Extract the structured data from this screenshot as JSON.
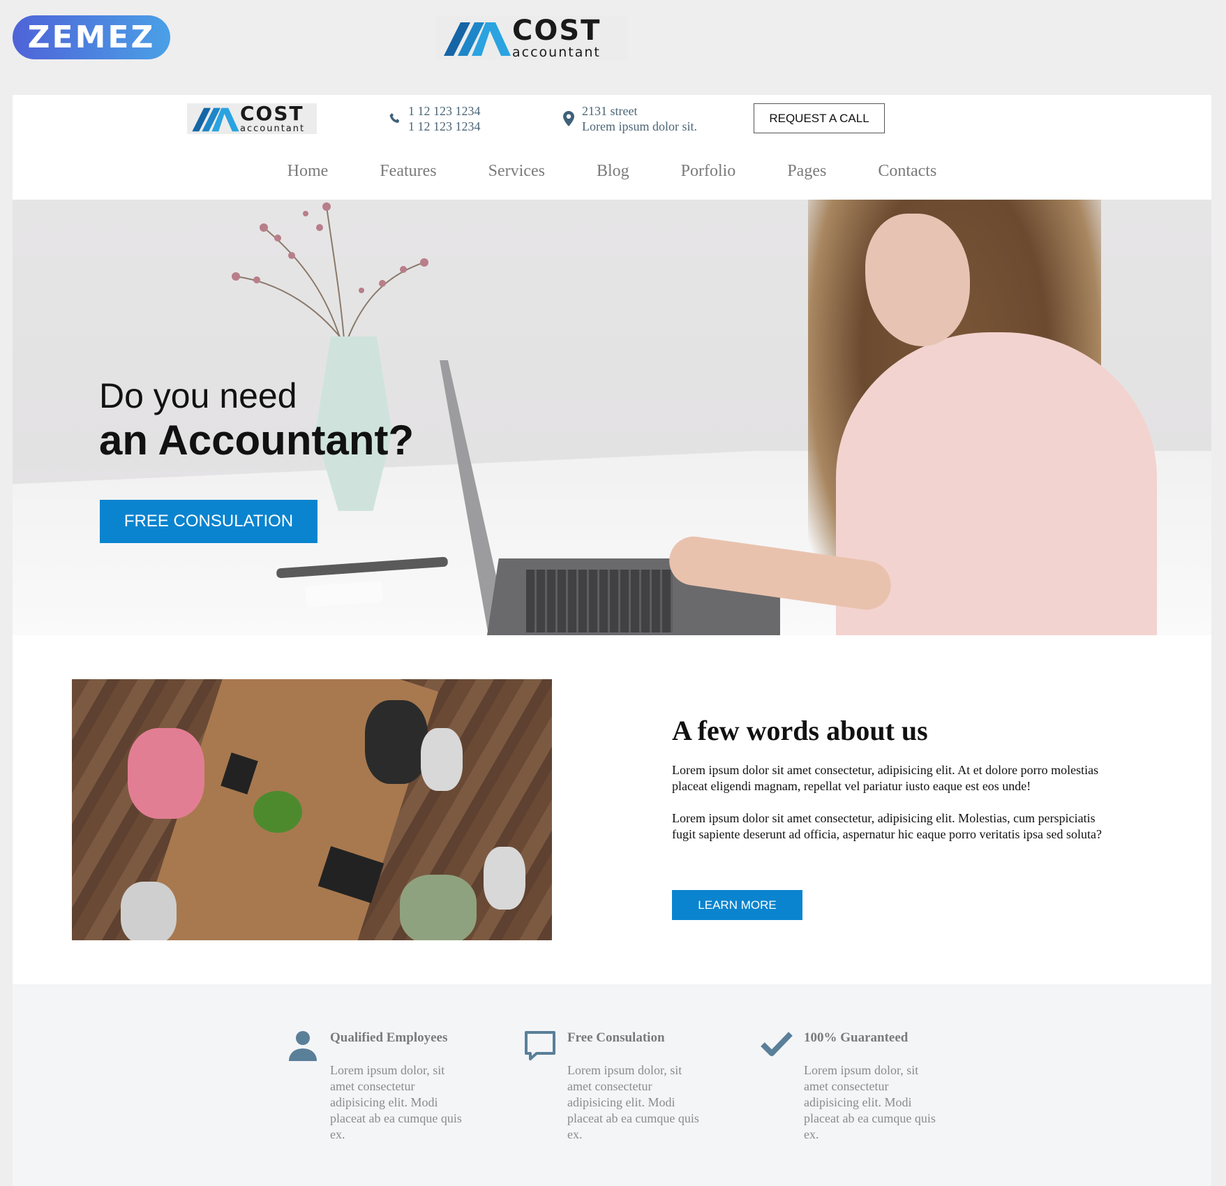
{
  "brand_bar": {
    "zemez_label": "ZEMEZ",
    "logo_word1": "COST",
    "logo_word2": "accountant"
  },
  "header": {
    "logo_word1": "COST",
    "logo_word2": "accountant",
    "phone_line1": "1 12 123 1234",
    "phone_line2": "1 12 123 1234",
    "address_line1": "2131 street",
    "address_line2": "Lorem ipsum dolor sit.",
    "request_button": "REQUEST A CALL"
  },
  "nav": {
    "items": [
      "Home",
      "Features",
      "Services",
      "Blog",
      "Porfolio",
      "Pages",
      "Contacts"
    ]
  },
  "hero": {
    "line1": "Do you need",
    "line2": "an Accountant?",
    "cta": "FREE CONSULATION"
  },
  "about": {
    "title": "A few words about us",
    "paragraph1": "Lorem ipsum dolor sit amet consectetur, adipisicing elit. At et dolore porro molestias placeat eligendi magnam, repellat vel pariatur iusto eaque est eos unde!",
    "paragraph2": "Lorem ipsum dolor sit amet consectetur, adipisicing elit. Molestias, cum perspiciatis fugit sapiente deserunt ad officia, aspernatur hic eaque porro veritatis ipsa sed soluta?",
    "button": "LEARN MORE"
  },
  "features": [
    {
      "icon": "user-icon",
      "title": "Qualified Employees",
      "desc": "Lorem ipsum dolor, sit amet consectetur adipisicing elit. Modi placeat ab ea cumque quis ex."
    },
    {
      "icon": "chat-bubble-icon",
      "title": "Free Consulation",
      "desc": "Lorem ipsum dolor, sit amet consectetur adipisicing elit. Modi placeat ab ea cumque quis ex."
    },
    {
      "icon": "checkmark-icon",
      "title": "100% Guaranteed",
      "desc": "Lorem ipsum dolor, sit amet consectetur adipisicing elit. Modi placeat ab ea cumque quis ex."
    }
  ],
  "colors": {
    "accent": "#0a84cf",
    "icon": "#5a7f99",
    "contact_text": "#4b6576",
    "nav_text": "#7b7b7b",
    "page_bg": "#eeeeef",
    "features_bg": "#f4f5f7"
  }
}
